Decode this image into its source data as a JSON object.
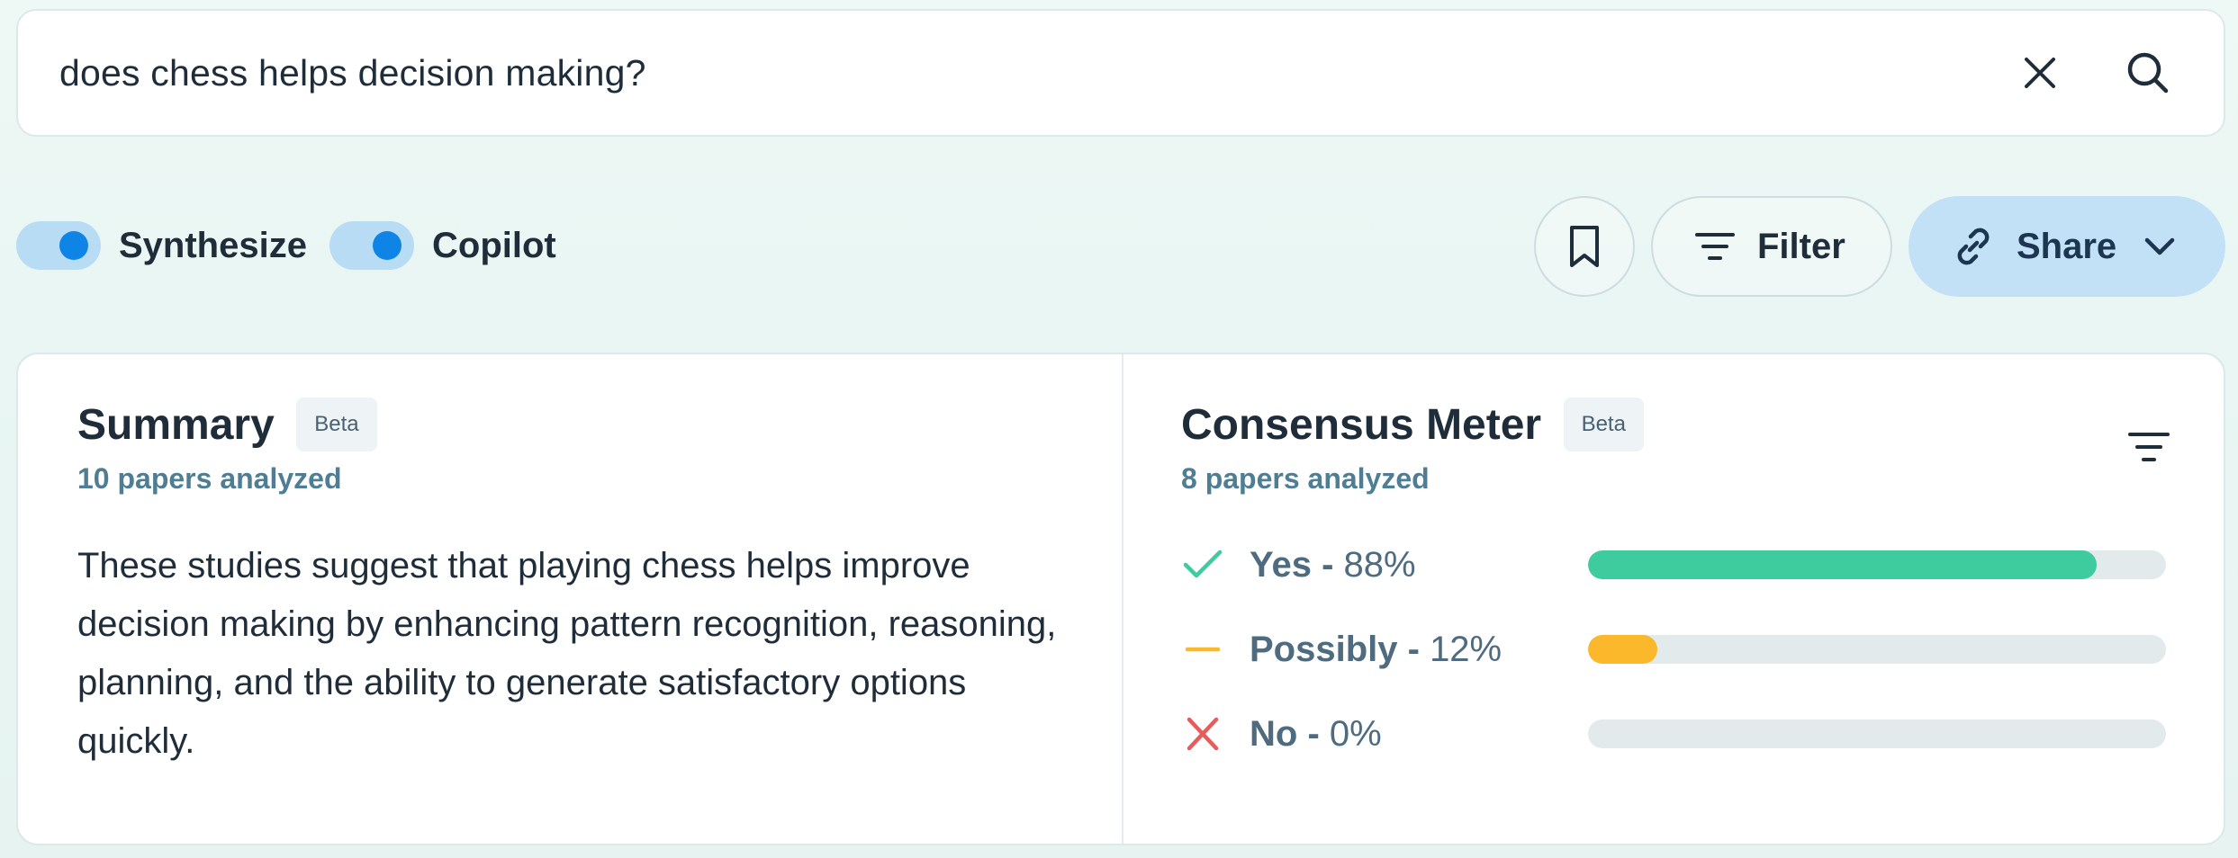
{
  "search": {
    "query": "does chess helps decision making?"
  },
  "toggles": [
    {
      "label": "Synthesize",
      "on": true
    },
    {
      "label": "Copilot",
      "on": true
    }
  ],
  "actions": {
    "filter_label": "Filter",
    "share_label": "Share"
  },
  "summary": {
    "title": "Summary",
    "badge": "Beta",
    "papers": "10 papers analyzed",
    "body": "These studies suggest that playing chess helps improve decision making by enhancing pattern recognition, reasoning, planning, and the ability to generate satisfactory options quickly."
  },
  "consensus": {
    "title": "Consensus Meter",
    "badge": "Beta",
    "papers": "8 papers analyzed",
    "rows": [
      {
        "answer": "Yes",
        "separator": " - ",
        "percent_text": "88%",
        "fraction": 0.88,
        "color": "#3ecb9e",
        "icon": "check-icon"
      },
      {
        "answer": "Possibly",
        "separator": " - ",
        "percent_text": "12%",
        "fraction": 0.12,
        "color": "#fbb82a",
        "icon": "dash-icon"
      },
      {
        "answer": "No",
        "separator": " - ",
        "percent_text": "0%",
        "fraction": 0.0,
        "color": "#e85b5b",
        "icon": "x-icon"
      }
    ]
  }
}
